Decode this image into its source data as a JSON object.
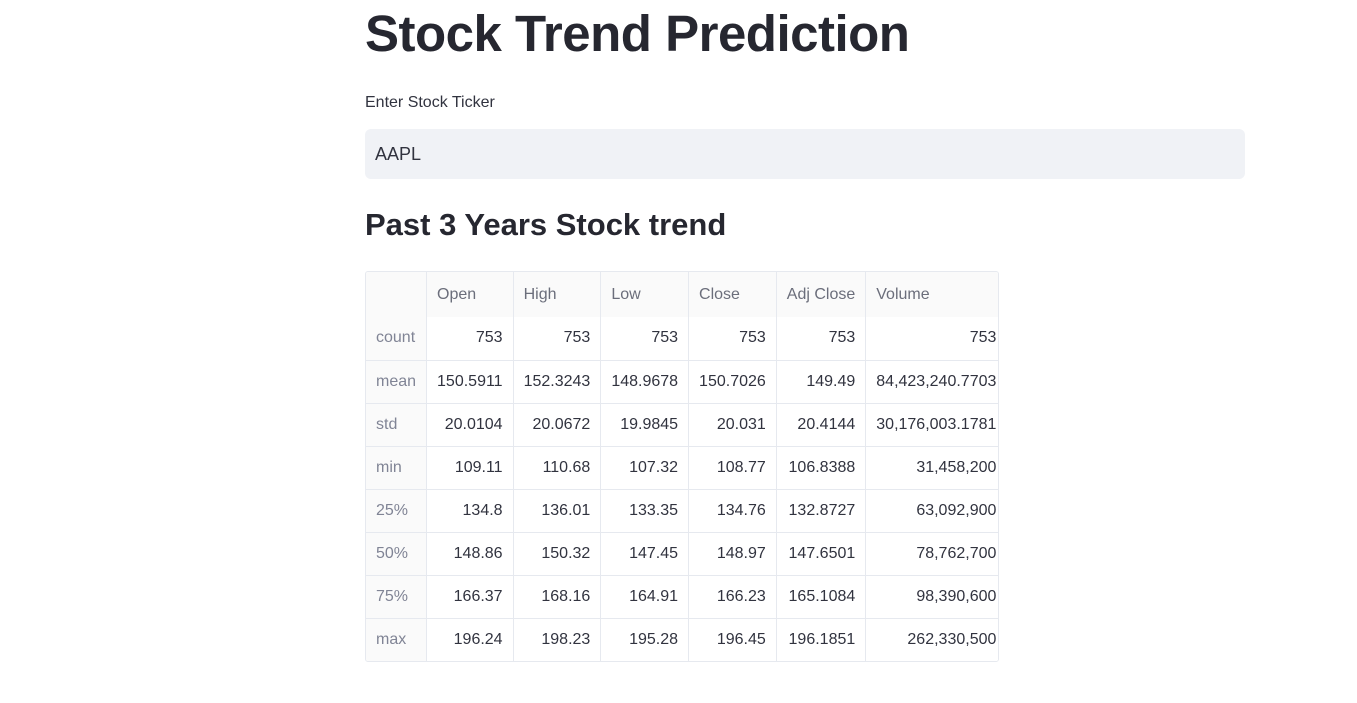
{
  "page": {
    "title": "Stock Trend Prediction"
  },
  "ticker": {
    "label": "Enter Stock Ticker",
    "value": "AAPL"
  },
  "section": {
    "heading": "Past 3 Years Stock trend"
  },
  "table": {
    "columns": [
      "",
      "Open",
      "High",
      "Low",
      "Close",
      "Adj Close",
      "Volume"
    ],
    "rows": [
      {
        "label": "count",
        "values": [
          "753",
          "753",
          "753",
          "753",
          "753",
          "753"
        ]
      },
      {
        "label": "mean",
        "values": [
          "150.5911",
          "152.3243",
          "148.9678",
          "150.7026",
          "149.49",
          "84,423,240.7703"
        ]
      },
      {
        "label": "std",
        "values": [
          "20.0104",
          "20.0672",
          "19.9845",
          "20.031",
          "20.4144",
          "30,176,003.1781"
        ]
      },
      {
        "label": "min",
        "values": [
          "109.11",
          "110.68",
          "107.32",
          "108.77",
          "106.8388",
          "31,458,200"
        ]
      },
      {
        "label": "25%",
        "values": [
          "134.8",
          "136.01",
          "133.35",
          "134.76",
          "132.8727",
          "63,092,900"
        ]
      },
      {
        "label": "50%",
        "values": [
          "148.86",
          "150.32",
          "147.45",
          "148.97",
          "147.6501",
          "78,762,700"
        ]
      },
      {
        "label": "75%",
        "values": [
          "166.37",
          "168.16",
          "164.91",
          "166.23",
          "165.1084",
          "98,390,600"
        ]
      },
      {
        "label": "max",
        "values": [
          "196.24",
          "198.23",
          "195.28",
          "196.45",
          "196.1851",
          "262,330,500"
        ]
      }
    ]
  }
}
